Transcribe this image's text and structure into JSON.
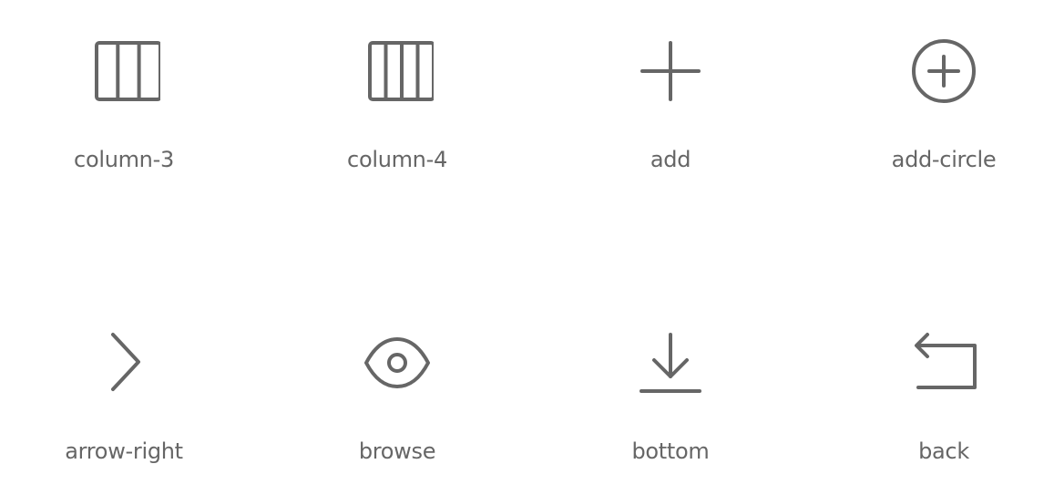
{
  "theme": {
    "icon_color": "#666666",
    "label_color": "#666666",
    "background": "#ffffff"
  },
  "icons": [
    {
      "label": "column-3",
      "icon": "column-3-icon"
    },
    {
      "label": "column-4",
      "icon": "column-4-icon"
    },
    {
      "label": "add",
      "icon": "add-icon"
    },
    {
      "label": "add-circle",
      "icon": "add-circle-icon"
    },
    {
      "label": "arrow-right",
      "icon": "arrow-right-icon"
    },
    {
      "label": "browse",
      "icon": "browse-icon"
    },
    {
      "label": "bottom",
      "icon": "bottom-icon"
    },
    {
      "label": "back",
      "icon": "back-icon"
    }
  ]
}
